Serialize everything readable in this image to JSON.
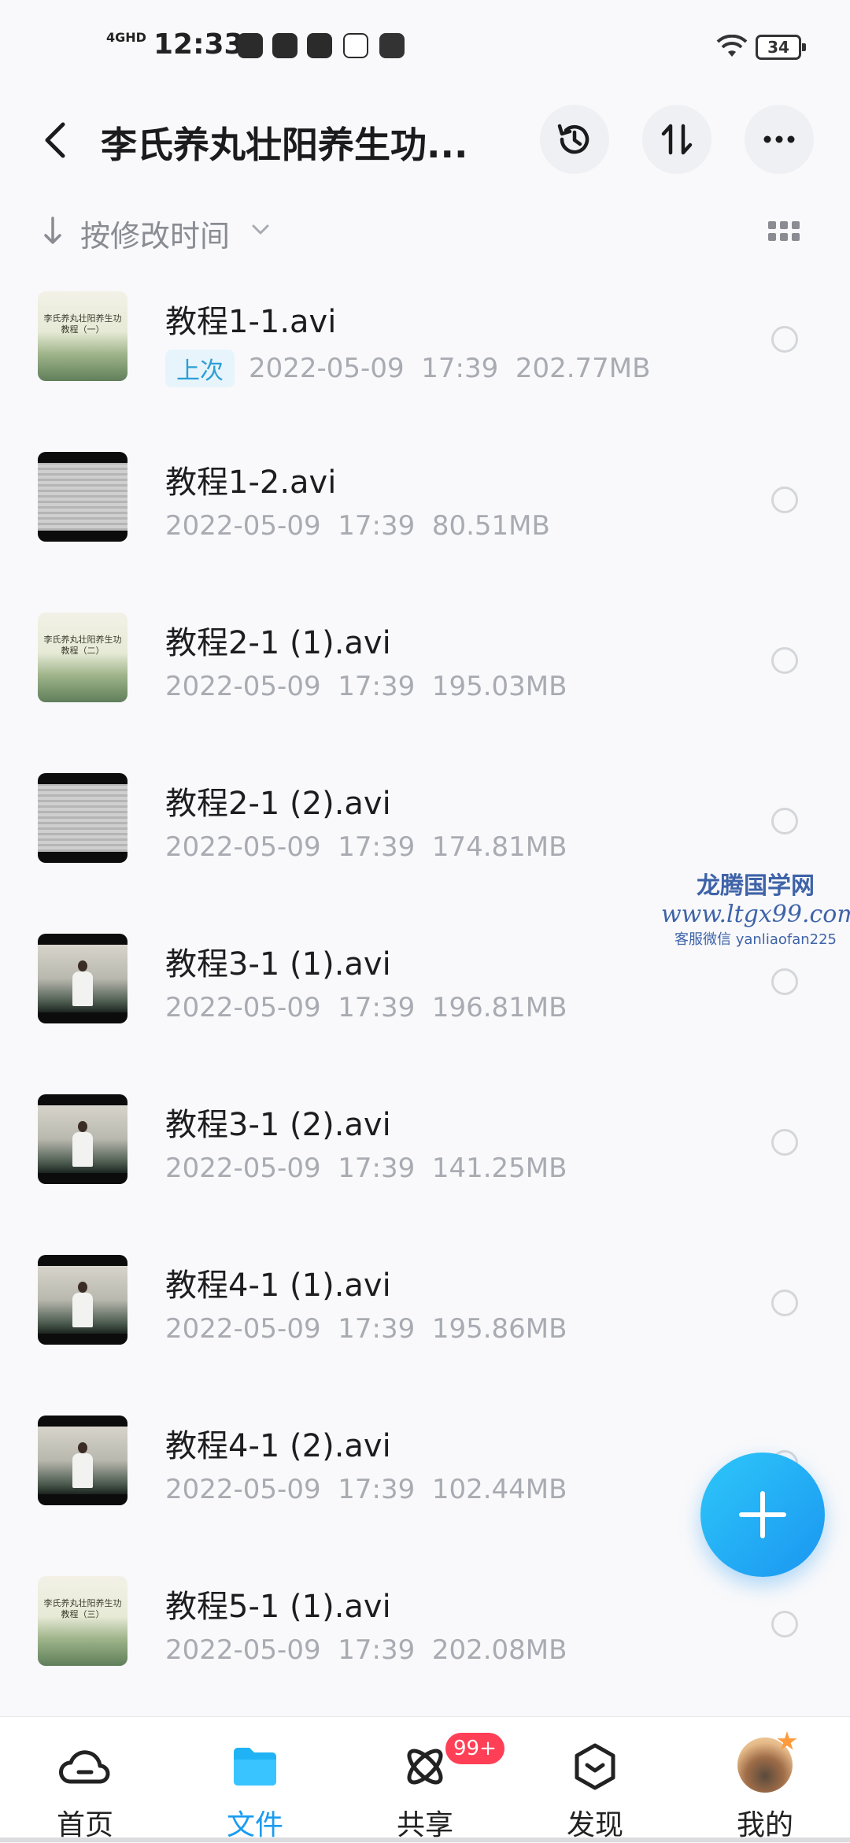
{
  "status_bar": {
    "time": "12:33",
    "network": "4GHD",
    "battery": "34"
  },
  "header": {
    "title": "李氏养丸壮阳养生功...",
    "back_icon": "chevron-left-icon",
    "actions": [
      "history-icon",
      "sort-transfer-icon",
      "more-icon"
    ]
  },
  "sort": {
    "label": "按修改时间"
  },
  "files": [
    {
      "name": "教程1-1.avi",
      "badge": "上次",
      "date": "2022-05-09",
      "time": "17:39",
      "size": "202.77MB",
      "thumb": "title-card",
      "caption": "李氏养丸壮阳养生功 教程（一）"
    },
    {
      "name": "教程1-2.avi",
      "badge": "",
      "date": "2022-05-09",
      "time": "17:39",
      "size": "80.51MB",
      "thumb": "document"
    },
    {
      "name": "教程2-1 (1).avi",
      "badge": "",
      "date": "2022-05-09",
      "time": "17:39",
      "size": "195.03MB",
      "thumb": "title-card",
      "caption": "李氏养丸壮阳养生功 教程（二）"
    },
    {
      "name": "教程2-1 (2).avi",
      "badge": "",
      "date": "2022-05-09",
      "time": "17:39",
      "size": "174.81MB",
      "thumb": "document"
    },
    {
      "name": "教程3-1 (1).avi",
      "badge": "",
      "date": "2022-05-09",
      "time": "17:39",
      "size": "196.81MB",
      "thumb": "person"
    },
    {
      "name": "教程3-1 (2).avi",
      "badge": "",
      "date": "2022-05-09",
      "time": "17:39",
      "size": "141.25MB",
      "thumb": "person"
    },
    {
      "name": "教程4-1 (1).avi",
      "badge": "",
      "date": "2022-05-09",
      "time": "17:39",
      "size": "195.86MB",
      "thumb": "person"
    },
    {
      "name": "教程4-1 (2).avi",
      "badge": "",
      "date": "2022-05-09",
      "time": "17:39",
      "size": "102.44MB",
      "thumb": "person"
    },
    {
      "name": "教程5-1 (1).avi",
      "badge": "",
      "date": "2022-05-09",
      "time": "17:39",
      "size": "202.08MB",
      "thumb": "title-card",
      "caption": "李氏养丸壮阳养生功 教程（三）"
    }
  ],
  "watermark": {
    "line1": "龙腾国学网",
    "line2": "www.ltgx99.com",
    "line3": "客服微信 yanliaofan225"
  },
  "tabs": [
    {
      "label": "首页",
      "icon": "home-cloud-icon",
      "active": false
    },
    {
      "label": "文件",
      "icon": "folder-icon",
      "active": true
    },
    {
      "label": "共享",
      "icon": "share-atom-icon",
      "active": false,
      "badge": "99+"
    },
    {
      "label": "发现",
      "icon": "discover-box-icon",
      "active": false
    },
    {
      "label": "我的",
      "icon": "avatar",
      "active": false
    }
  ],
  "colors": {
    "accent": "#1a9cf0",
    "badge_red": "#ff3f56",
    "meta_gray": "#a9abb2"
  }
}
